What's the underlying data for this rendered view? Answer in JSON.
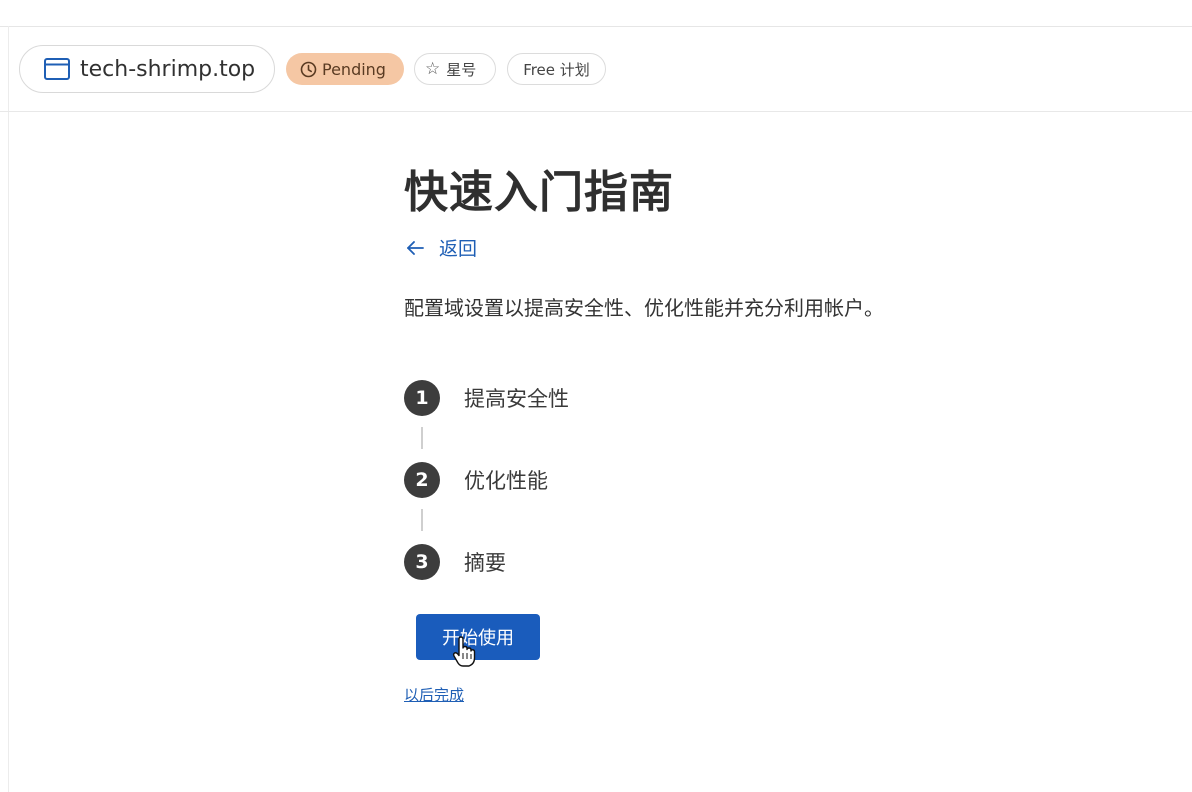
{
  "header": {
    "domain": {
      "name": "tech-shrimp.top",
      "icon": "browser-window-icon"
    },
    "status": {
      "label": "Pending",
      "icon": "clock-icon",
      "color": "#f5c7a4"
    },
    "star": {
      "label": "星号",
      "icon": "star-outline-icon"
    },
    "plan": {
      "label": "Free 计划"
    }
  },
  "main": {
    "title": "快速入门指南",
    "back": {
      "label": "返回",
      "icon": "arrow-left-icon"
    },
    "description": "配置域设置以提高安全性、优化性能并充分利用帐户。",
    "steps": [
      {
        "number": "1",
        "label": "提高安全性"
      },
      {
        "number": "2",
        "label": "优化性能"
      },
      {
        "number": "3",
        "label": "摘要"
      }
    ],
    "start_button": "开始使用",
    "later_link": "以后完成"
  },
  "colors": {
    "accent": "#1a5cbc",
    "link": "#1f5fb5",
    "step_circle": "#3d3d3d",
    "pending_badge": "#f5c7a4"
  }
}
